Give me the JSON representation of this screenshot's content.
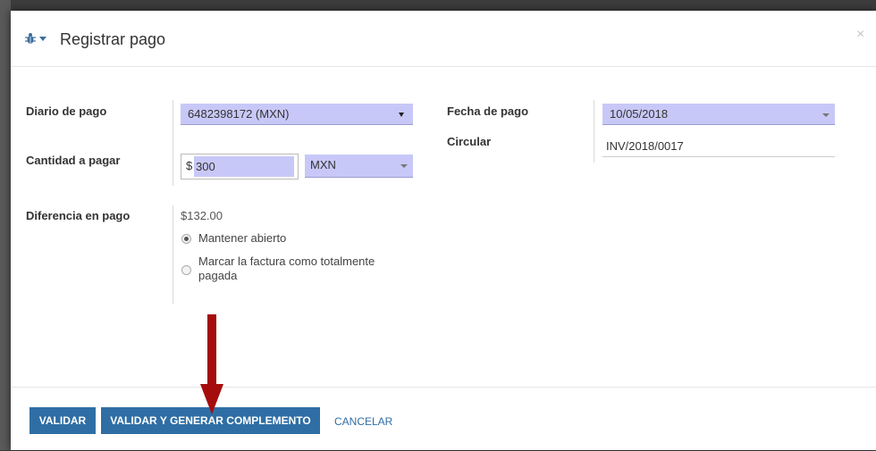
{
  "dialog": {
    "title": "Registrar pago",
    "close_symbol": "×"
  },
  "form": {
    "payment_journal": {
      "label": "Diario de pago",
      "value": "6482398172 (MXN)"
    },
    "amount": {
      "label": "Cantidad a pagar",
      "currency_symbol": "$",
      "value": "300",
      "currency": "MXN"
    },
    "payment_date": {
      "label": "Fecha de pago",
      "value": "10/05/2018"
    },
    "memo": {
      "label": "Circular",
      "value": "INV/2018/0017"
    },
    "difference": {
      "label": "Diferencia en pago",
      "amount": "$132.00",
      "options": [
        {
          "label": "Mantener abierto",
          "checked": true
        },
        {
          "label_line1": "Marcar la factura como totalmente",
          "label_line2": "pagada",
          "checked": false
        }
      ]
    }
  },
  "footer": {
    "validate": "VALIDAR",
    "validate_generate": "VALIDAR Y GENERAR COMPLEMENTO",
    "cancel": "CANCELAR"
  },
  "icons": {
    "header": "bug-icon",
    "dropdown": "caret-down-icon",
    "close": "close-icon",
    "annotation": "arrow-down-icon"
  },
  "colors": {
    "primary": "#2f6ea5",
    "field_highlight": "#c8c8f8",
    "arrow": "#a50d0d"
  }
}
